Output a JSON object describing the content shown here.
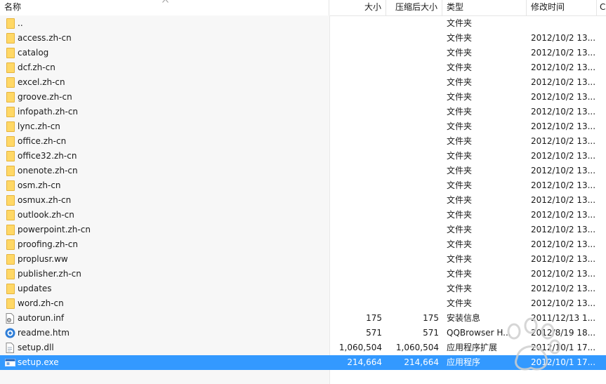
{
  "columns": {
    "name": "名称",
    "size": "大小",
    "packed": "压缩后大小",
    "type": "类型",
    "modified": "修改时间",
    "extra": "C"
  },
  "files": [
    {
      "name": "..",
      "size": "",
      "packed": "",
      "type": "文件夹",
      "modified": "",
      "icon": "folder-icon"
    },
    {
      "name": "access.zh-cn",
      "size": "",
      "packed": "",
      "type": "文件夹",
      "modified": "2012/10/2 13...",
      "icon": "folder-icon"
    },
    {
      "name": "catalog",
      "size": "",
      "packed": "",
      "type": "文件夹",
      "modified": "2012/10/2 13...",
      "icon": "folder-icon"
    },
    {
      "name": "dcf.zh-cn",
      "size": "",
      "packed": "",
      "type": "文件夹",
      "modified": "2012/10/2 13...",
      "icon": "folder-icon"
    },
    {
      "name": "excel.zh-cn",
      "size": "",
      "packed": "",
      "type": "文件夹",
      "modified": "2012/10/2 13...",
      "icon": "folder-icon"
    },
    {
      "name": "groove.zh-cn",
      "size": "",
      "packed": "",
      "type": "文件夹",
      "modified": "2012/10/2 13...",
      "icon": "folder-icon"
    },
    {
      "name": "infopath.zh-cn",
      "size": "",
      "packed": "",
      "type": "文件夹",
      "modified": "2012/10/2 13...",
      "icon": "folder-icon"
    },
    {
      "name": "lync.zh-cn",
      "size": "",
      "packed": "",
      "type": "文件夹",
      "modified": "2012/10/2 13...",
      "icon": "folder-icon"
    },
    {
      "name": "office.zh-cn",
      "size": "",
      "packed": "",
      "type": "文件夹",
      "modified": "2012/10/2 13...",
      "icon": "folder-icon"
    },
    {
      "name": "office32.zh-cn",
      "size": "",
      "packed": "",
      "type": "文件夹",
      "modified": "2012/10/2 13...",
      "icon": "folder-icon"
    },
    {
      "name": "onenote.zh-cn",
      "size": "",
      "packed": "",
      "type": "文件夹",
      "modified": "2012/10/2 13...",
      "icon": "folder-icon"
    },
    {
      "name": "osm.zh-cn",
      "size": "",
      "packed": "",
      "type": "文件夹",
      "modified": "2012/10/2 13...",
      "icon": "folder-icon"
    },
    {
      "name": "osmux.zh-cn",
      "size": "",
      "packed": "",
      "type": "文件夹",
      "modified": "2012/10/2 13...",
      "icon": "folder-icon"
    },
    {
      "name": "outlook.zh-cn",
      "size": "",
      "packed": "",
      "type": "文件夹",
      "modified": "2012/10/2 13...",
      "icon": "folder-icon"
    },
    {
      "name": "powerpoint.zh-cn",
      "size": "",
      "packed": "",
      "type": "文件夹",
      "modified": "2012/10/2 13...",
      "icon": "folder-icon"
    },
    {
      "name": "proofing.zh-cn",
      "size": "",
      "packed": "",
      "type": "文件夹",
      "modified": "2012/10/2 13...",
      "icon": "folder-icon"
    },
    {
      "name": "proplusr.ww",
      "size": "",
      "packed": "",
      "type": "文件夹",
      "modified": "2012/10/2 13...",
      "icon": "folder-icon"
    },
    {
      "name": "publisher.zh-cn",
      "size": "",
      "packed": "",
      "type": "文件夹",
      "modified": "2012/10/2 13...",
      "icon": "folder-icon"
    },
    {
      "name": "updates",
      "size": "",
      "packed": "",
      "type": "文件夹",
      "modified": "2012/10/2 13...",
      "icon": "folder-icon"
    },
    {
      "name": "word.zh-cn",
      "size": "",
      "packed": "",
      "type": "文件夹",
      "modified": "2012/10/2 13...",
      "icon": "folder-icon"
    },
    {
      "name": "autorun.inf",
      "size": "175",
      "packed": "175",
      "type": "安装信息",
      "modified": "2011/12/13 1...",
      "icon": "settings-file-icon"
    },
    {
      "name": "readme.htm",
      "size": "571",
      "packed": "571",
      "type": "QQBrowser H...",
      "modified": "2012/8/19 18...",
      "icon": "browser-file-icon"
    },
    {
      "name": "setup.dll",
      "size": "1,060,504",
      "packed": "1,060,504",
      "type": "应用程序扩展",
      "modified": "2012/10/1 17...",
      "icon": "dll-file-icon"
    },
    {
      "name": "setup.exe",
      "size": "214,664",
      "packed": "214,664",
      "type": "应用程序",
      "modified": "2012/10/1 17...",
      "icon": "exe-file-icon",
      "selected": true
    }
  ],
  "watermark": "jingyan.baidu.com",
  "colors": {
    "selection": "#3399ff",
    "folder": "#ffd866",
    "header_border": "#e5e5e5"
  }
}
